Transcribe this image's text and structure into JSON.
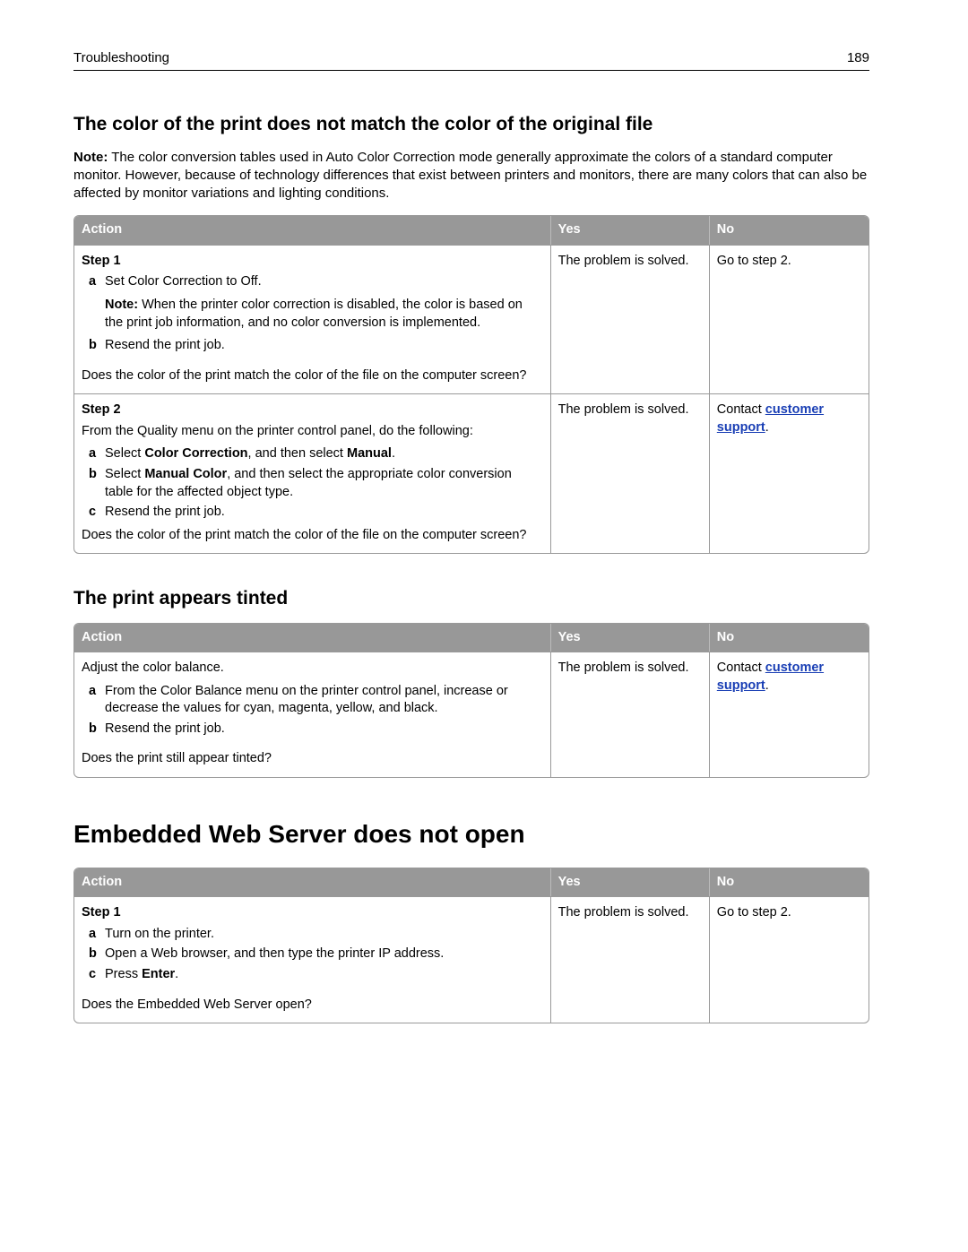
{
  "header": {
    "section": "Troubleshooting",
    "page": "189"
  },
  "section1": {
    "title": "The color of the print does not match the color of the original file",
    "note_label": "Note:",
    "note_text": " The color conversion tables used in Auto Color Correction mode generally approximate the colors of a standard computer monitor. However, because of technology differences that exist between printers and monitors, there are many colors that can also be affected by monitor variations and lighting conditions.",
    "cols": {
      "action": "Action",
      "yes": "Yes",
      "no": "No"
    },
    "step1": {
      "label": "Step 1",
      "a_pre": "Set Color Correction to Off.",
      "note_label": "Note:",
      "note_text": " When the printer color correction is disabled, the color is based on the print job information, and no color conversion is implemented.",
      "b": "Resend the print job.",
      "question": "Does the color of the print match the color of the file on the computer screen?",
      "yes": "The problem is solved.",
      "no": "Go to step 2."
    },
    "step2": {
      "label": "Step 2",
      "intro": "From the Quality menu on the printer control panel, do the following:",
      "a_pre": "Select ",
      "a_b1": "Color Correction",
      "a_mid": ", and then select ",
      "a_b2": "Manual",
      "a_post": ".",
      "b_pre": "Select ",
      "b_b1": "Manual Color",
      "b_post": ", and then select the appropriate color conversion table for the affected object type.",
      "c": "Resend the print job.",
      "question": "Does the color of the print match the color of the file on the computer screen?",
      "yes": "The problem is solved.",
      "no_pre": "Contact ",
      "no_link": "customer support",
      "no_post": "."
    }
  },
  "section2": {
    "title": "The print appears tinted",
    "cols": {
      "action": "Action",
      "yes": "Yes",
      "no": "No"
    },
    "row": {
      "intro": "Adjust the color balance.",
      "a": "From the Color Balance menu on the printer control panel, increase or decrease the values for cyan, magenta, yellow, and black.",
      "b": "Resend the print job.",
      "question": "Does the print still appear tinted?",
      "yes": "The problem is solved.",
      "no_pre": "Contact ",
      "no_link": "customer support",
      "no_post": "."
    }
  },
  "section3": {
    "title": "Embedded Web Server does not open",
    "cols": {
      "action": "Action",
      "yes": "Yes",
      "no": "No"
    },
    "step1": {
      "label": "Step 1",
      "a": "Turn on the printer.",
      "b": "Open a Web browser, and then type the printer IP address.",
      "c_pre": "Press ",
      "c_b": "Enter",
      "c_post": ".",
      "question": "Does the Embedded Web Server open?",
      "yes": "The problem is solved.",
      "no": "Go to step 2."
    }
  }
}
